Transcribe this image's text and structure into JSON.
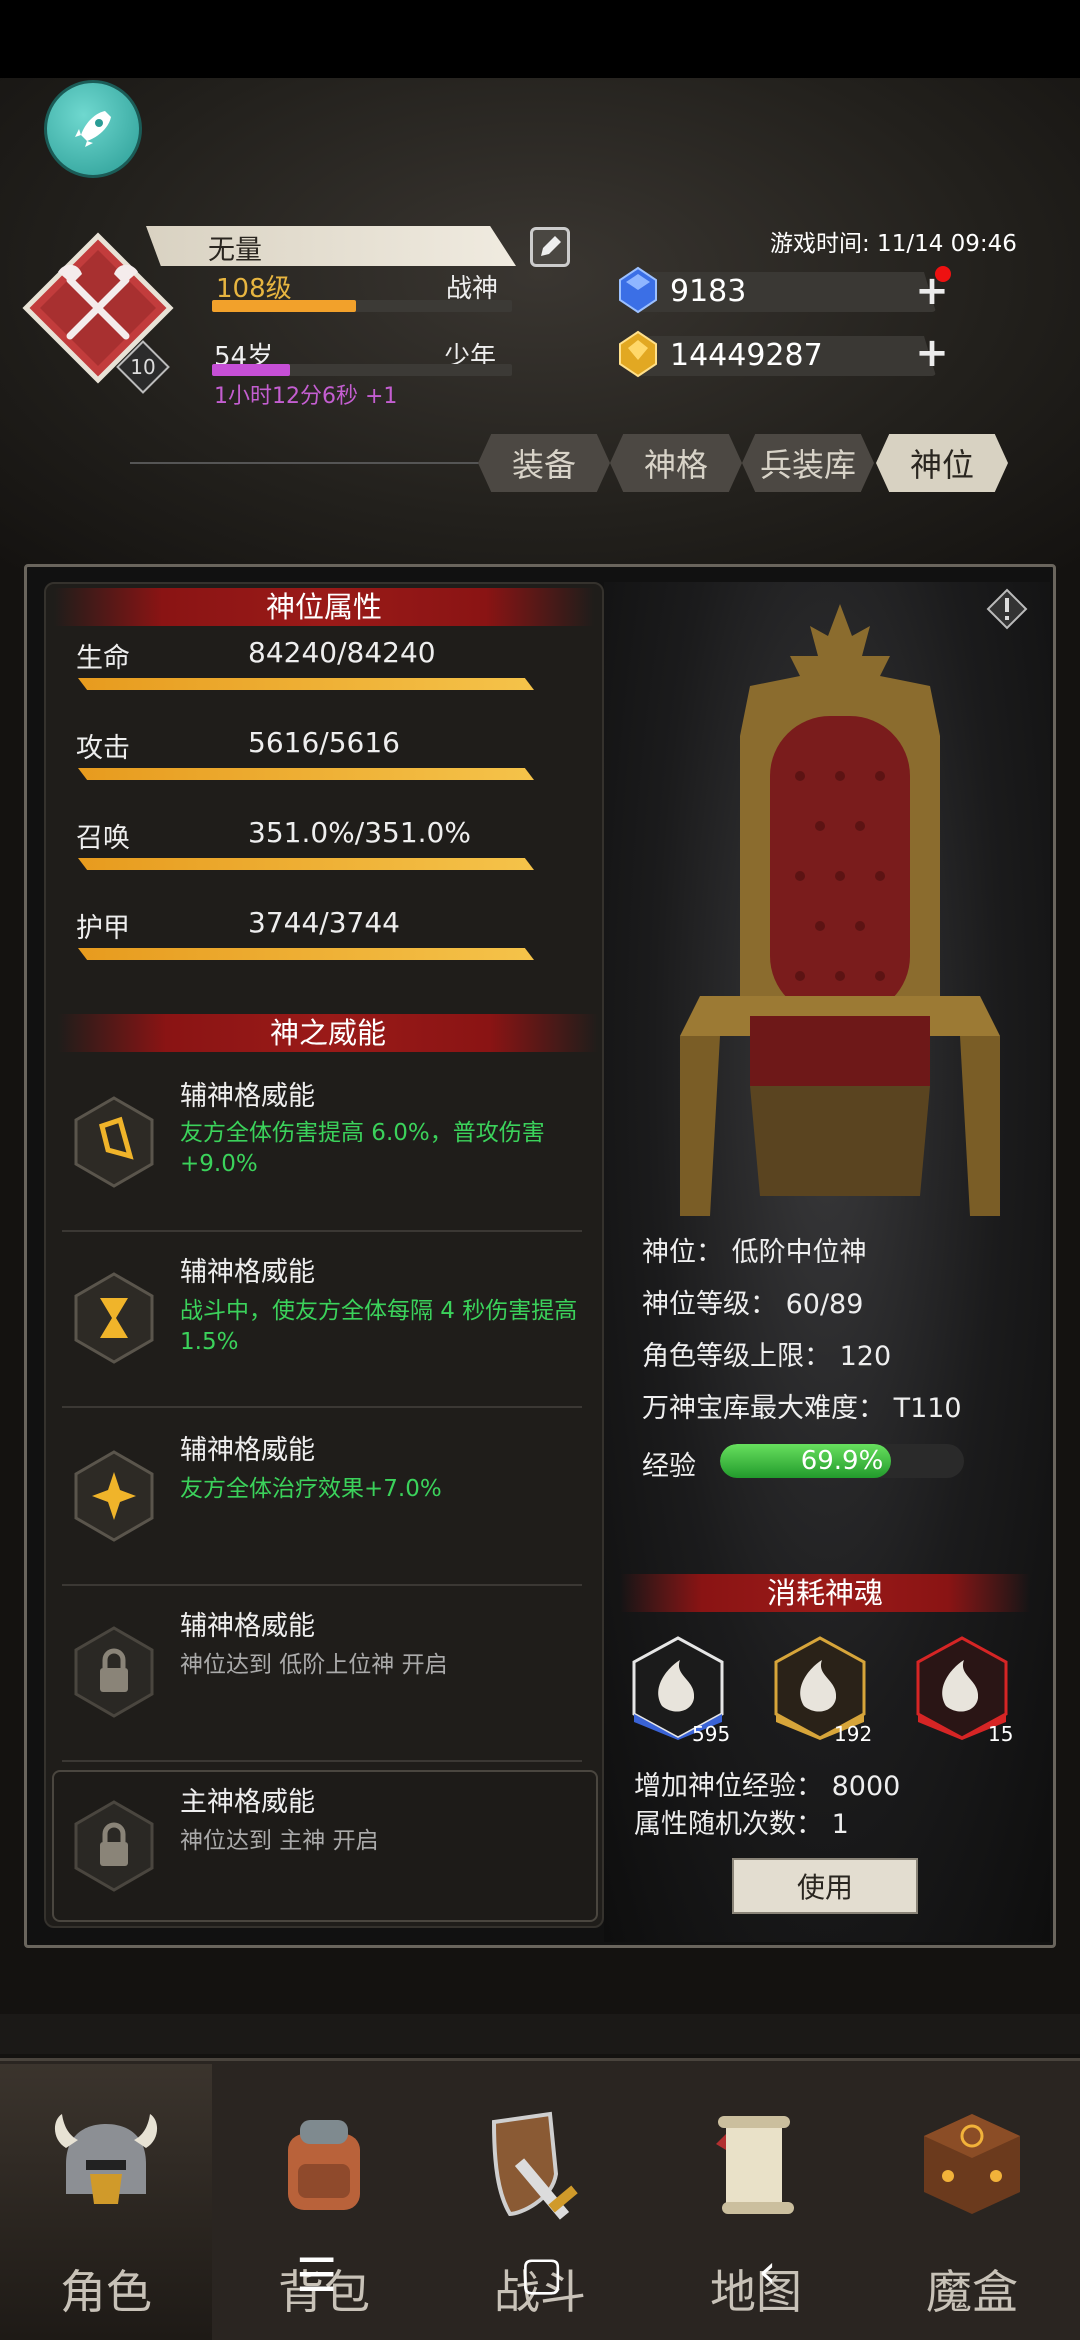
{
  "header": {
    "player_name": "无量",
    "level": "108级",
    "rank": "战神",
    "age": "54岁",
    "age_rank": "少年",
    "timer": "1小时12分6秒 +1",
    "emblem_level": "10",
    "game_time": "游戏时间: 11/14 09:46",
    "gems": "9183",
    "gold": "14449287",
    "level_progress": 0.48,
    "age_progress": 0.26
  },
  "tabs": [
    {
      "label": "装备",
      "active": false
    },
    {
      "label": "神格",
      "active": false
    },
    {
      "label": "兵装库",
      "active": false
    },
    {
      "label": "神位",
      "active": true
    }
  ],
  "attributes": {
    "title": "神位属性",
    "items": [
      {
        "label": "生命",
        "value": "84240/84240"
      },
      {
        "label": "攻击",
        "value": "5616/5616"
      },
      {
        "label": "召唤",
        "value": "351.0%/351.0%"
      },
      {
        "label": "护甲",
        "value": "3744/3744"
      }
    ]
  },
  "powers": {
    "title": "神之威能",
    "items": [
      {
        "name": "辅神格威能",
        "desc": "友方全体伤害提高 6.0%，普攻伤害+9.0%",
        "locked": false
      },
      {
        "name": "辅神格威能",
        "desc": "战斗中，使友方全体每隔 4 秒伤害提高 1.5%",
        "locked": false
      },
      {
        "name": "辅神格威能",
        "desc": "友方全体治疗效果+7.0%",
        "locked": false
      },
      {
        "name": "辅神格威能",
        "desc": "神位达到 低阶上位神 开启",
        "locked": true
      },
      {
        "name": "主神格威能",
        "desc": "神位达到 主神 开启",
        "locked": true
      }
    ]
  },
  "throne": {
    "position": "神位：  低阶中位神",
    "position_level": "神位等级：  60/89",
    "char_level_cap": "角色等级上限：  120",
    "vault_difficulty": "万神宝库最大难度：  T110",
    "exp_label": "经验",
    "exp_pct": "69.9%",
    "exp_value": 0.699
  },
  "souls": {
    "title": "消耗神魂",
    "items": [
      {
        "count": "595",
        "color": "#3a63d6"
      },
      {
        "count": "192",
        "color": "#d7a53a"
      },
      {
        "count": "15",
        "color": "#d62525"
      }
    ],
    "exp_gain": "增加神位经验：  8000",
    "random_times": "属性随机次数：  1",
    "use_label": "使用"
  },
  "nav": [
    {
      "label": "角色",
      "icon": "helmet-icon",
      "active": true
    },
    {
      "label": "背包",
      "icon": "backpack-icon",
      "active": false
    },
    {
      "label": "战斗",
      "icon": "sword-shield-icon",
      "active": false
    },
    {
      "label": "地图",
      "icon": "scroll-map-icon",
      "active": false
    },
    {
      "label": "魔盒",
      "icon": "magic-box-icon",
      "active": false
    }
  ],
  "system_nav": {
    "menu": "☰",
    "home": "▢",
    "back": "‹"
  }
}
